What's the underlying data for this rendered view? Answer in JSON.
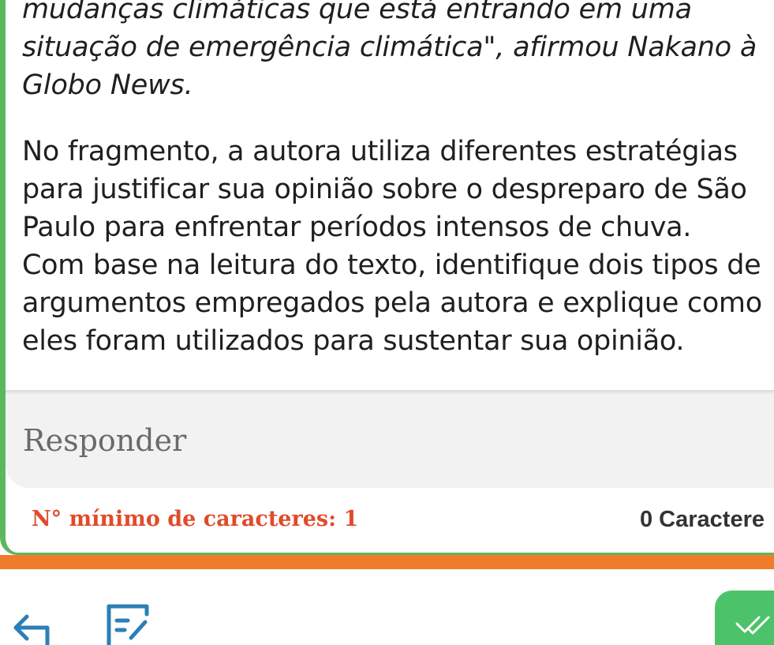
{
  "fragment": {
    "text": "mudanças climáticas que está entrando em uma\nsituação de emergência climática\", afirmou Nakano à\nGlobo News."
  },
  "question": {
    "text": "No fragmento, a autora utiliza diferentes estratégias\npara justificar sua opinião sobre o despreparo de São\nPaulo para enfrentar períodos intensos de chuva.\nCom base na leitura do texto, identifique dois tipos de\nargumentos empregados pela autora e explique como\neles foram utilizados para sustentar sua opinião."
  },
  "answer": {
    "placeholder": "Responder",
    "min_chars_label": "N° mínimo de caracteres: 1",
    "char_count_label": "0 Caractere"
  },
  "colors": {
    "accent_green": "#5cb85c",
    "orange_bar": "#f07c2a",
    "min_chars_red": "#e14b2a",
    "done_green": "#4cc36a"
  },
  "icons": {
    "back": "arrow-left-icon",
    "edit": "edit-note-icon",
    "done": "double-check-icon"
  }
}
